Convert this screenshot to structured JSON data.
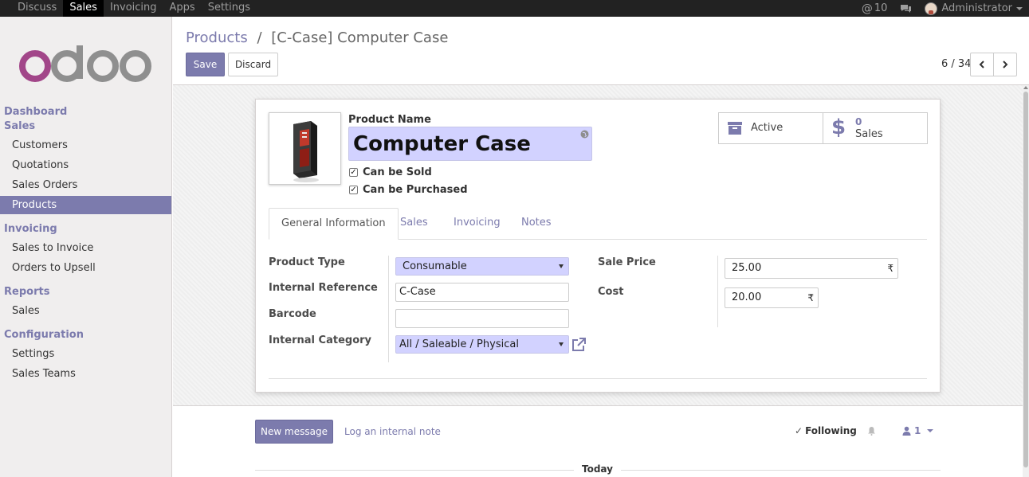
{
  "topbar": {
    "menu": [
      "Discuss",
      "Sales",
      "Invoicing",
      "Apps",
      "Settings"
    ],
    "active": "Sales",
    "messages_count": "10",
    "user": "Administrator"
  },
  "sidebar": {
    "logo": "odoo",
    "dashboard": "Dashboard",
    "sales_section": "Sales",
    "sales_items": [
      "Customers",
      "Quotations",
      "Sales Orders",
      "Products"
    ],
    "invoicing_section": "Invoicing",
    "invoicing_items": [
      "Sales to Invoice",
      "Orders to Upsell"
    ],
    "reports_section": "Reports",
    "reports_items": [
      "Sales"
    ],
    "configuration_section": "Configuration",
    "configuration_items": [
      "Settings",
      "Sales Teams"
    ],
    "active_item": "Products"
  },
  "control": {
    "breadcrumb_link": "Products",
    "breadcrumb_sep": "/",
    "breadcrumb_current": "[C-Case] Computer Case",
    "save_label": "Save",
    "discard_label": "Discard",
    "pager": "6 / 34"
  },
  "product": {
    "name_label": "Product Name",
    "name": "Computer Case",
    "can_be_sold": "Can be Sold",
    "can_be_purchased": "Can be Purchased",
    "active_label": "Active",
    "sales_count": "0",
    "sales_label": "Sales"
  },
  "tabs": [
    "General Information",
    "Sales",
    "Invoicing",
    "Notes"
  ],
  "fields": {
    "product_type_label": "Product Type",
    "product_type": "Consumable",
    "internal_reference_label": "Internal Reference",
    "internal_reference": "C-Case",
    "barcode_label": "Barcode",
    "barcode": "",
    "internal_category_label": "Internal Category",
    "internal_category": "All / Saleable / Physical",
    "sale_price_label": "Sale Price",
    "sale_price": "25.00",
    "cost_label": "Cost",
    "cost": "20.00",
    "currency": "₹"
  },
  "chatter": {
    "new_message": "New message",
    "log_note": "Log an internal note",
    "following": "Following",
    "followers_count": "1",
    "today": "Today"
  },
  "colors": {
    "accent": "#7c7bad",
    "required_bg": "#d2d2ff",
    "topbar": "#222222"
  }
}
